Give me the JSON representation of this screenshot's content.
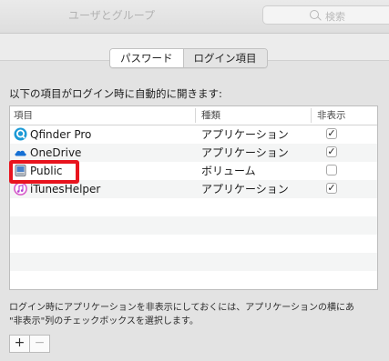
{
  "window": {
    "title": "ユーザとグループ"
  },
  "search": {
    "placeholder": "検索",
    "icon": "search-icon"
  },
  "tabs": [
    {
      "label": "パスワード",
      "selected": true
    },
    {
      "label": "ログイン項目",
      "selected": false
    }
  ],
  "intro_text": "以下の項目がログイン時に自動的に開きます:",
  "table": {
    "headers": {
      "item": "項目",
      "kind": "種類",
      "hide": "非表示"
    },
    "rows": [
      {
        "name": "Qfinder Pro",
        "kind": "アプリケーション",
        "hidden": true,
        "icon": "qfinder-icon",
        "check_glyph": "✓"
      },
      {
        "name": "OneDrive",
        "kind": "アプリケーション",
        "hidden": true,
        "icon": "onedrive-icon",
        "check_glyph": "✓"
      },
      {
        "name": "Public",
        "kind": "ボリューム",
        "hidden": false,
        "icon": "volume-icon",
        "check_glyph": ""
      },
      {
        "name": "iTunesHelper",
        "kind": "アプリケーション",
        "hidden": true,
        "icon": "itunes-icon",
        "check_glyph": "✓"
      }
    ],
    "empty_rows": 6
  },
  "highlight": {
    "target": "Public",
    "color": "#e8141e"
  },
  "footer": {
    "note_line1": "ログイン時にアプリケーションを非表示にしておくには、アプリケーションの横にあ",
    "note_line2": "\"非表示\"列のチェックボックスを選択します。",
    "add_label": "+",
    "remove_label": "−"
  }
}
